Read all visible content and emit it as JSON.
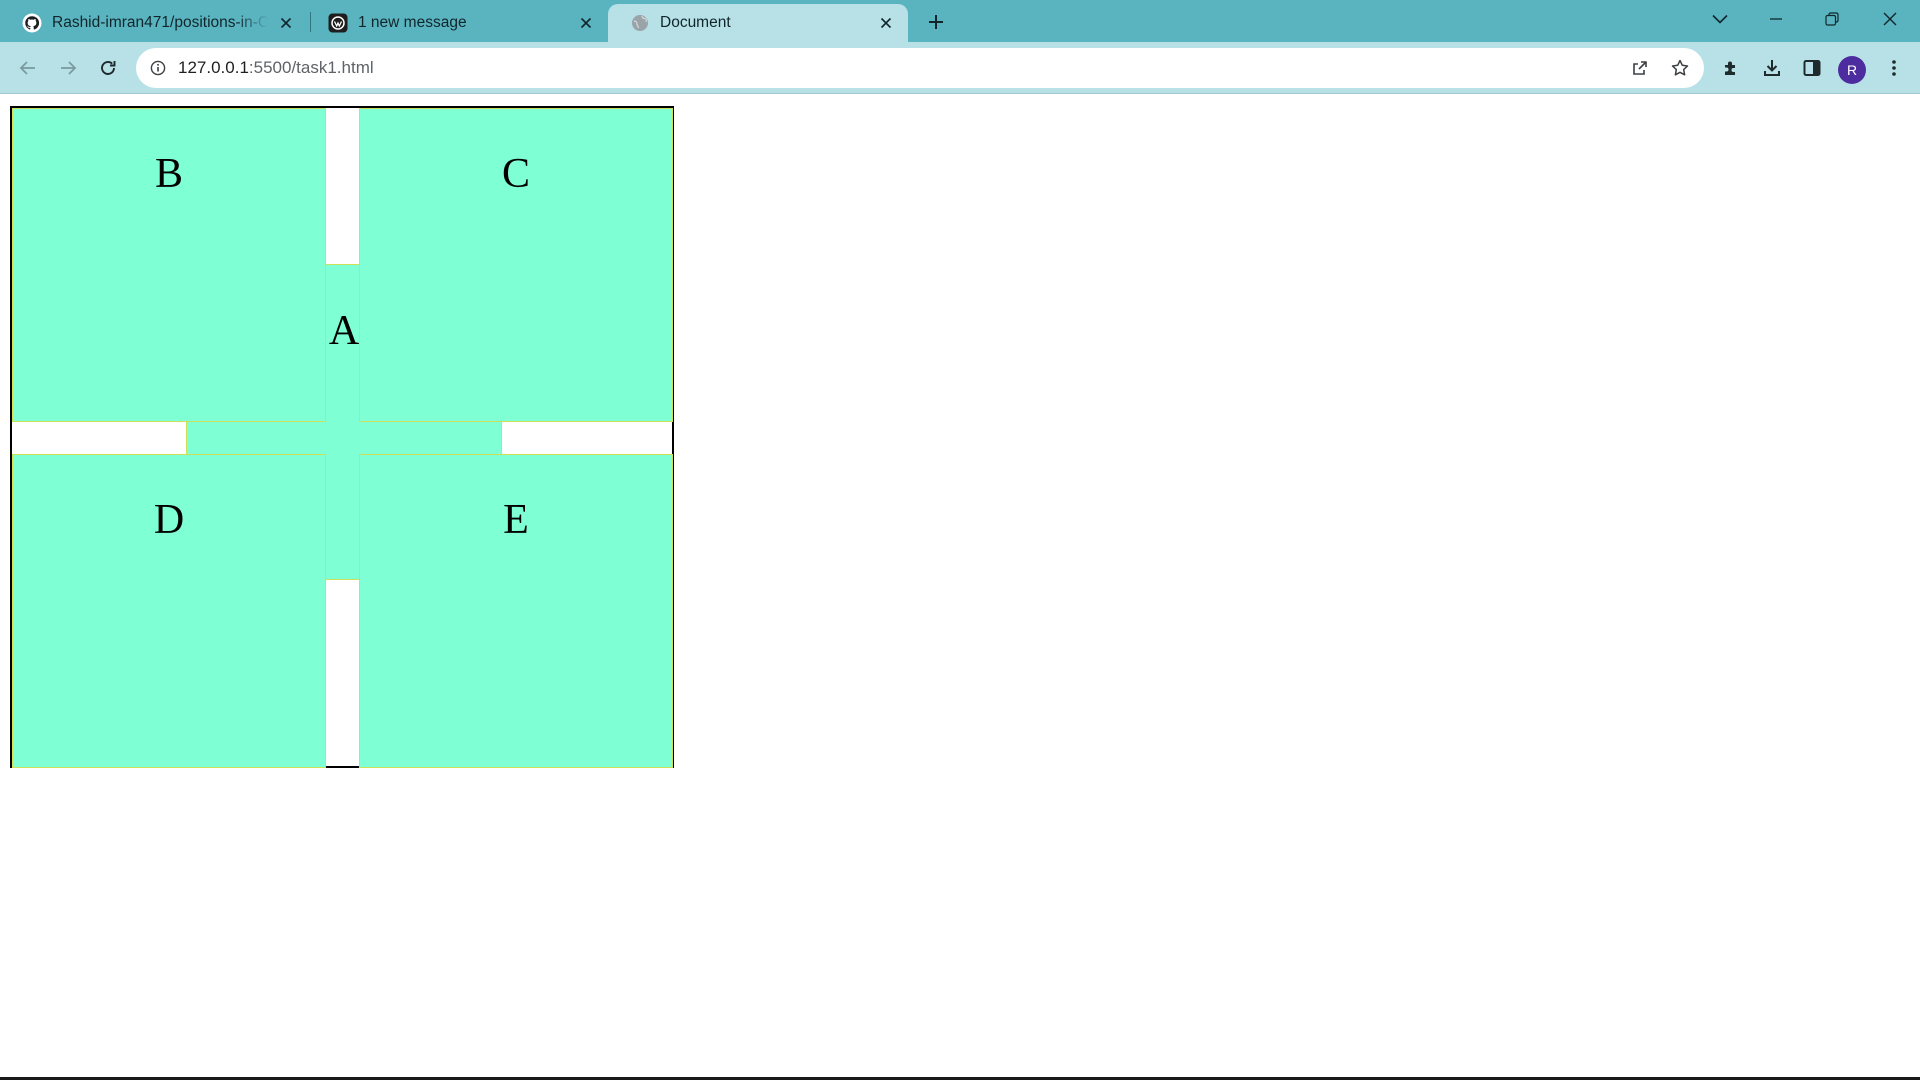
{
  "browser": {
    "tabs": [
      {
        "title": "Rashid-imran471/positions-in-C",
        "favicon": "github-icon",
        "active": false
      },
      {
        "title": "1 new message",
        "favicon": "mail-app-icon",
        "active": false
      },
      {
        "title": "Document",
        "favicon": "globe-icon",
        "active": true
      }
    ],
    "address_bar": {
      "host": "127.0.0.1",
      "path": ":5500/task1.html"
    },
    "profile_initial": "R",
    "colors": {
      "frame": "#5ab4c0",
      "toolbar": "#b7e1e7",
      "avatar": "#4d2ca0"
    }
  },
  "page": {
    "boxes": {
      "a": "A",
      "b": "B",
      "c": "C",
      "d": "D",
      "e": "E"
    },
    "colors": {
      "box_fill": "#7fffd4",
      "box_border": "#cde05a",
      "container_border": "#000000"
    }
  }
}
